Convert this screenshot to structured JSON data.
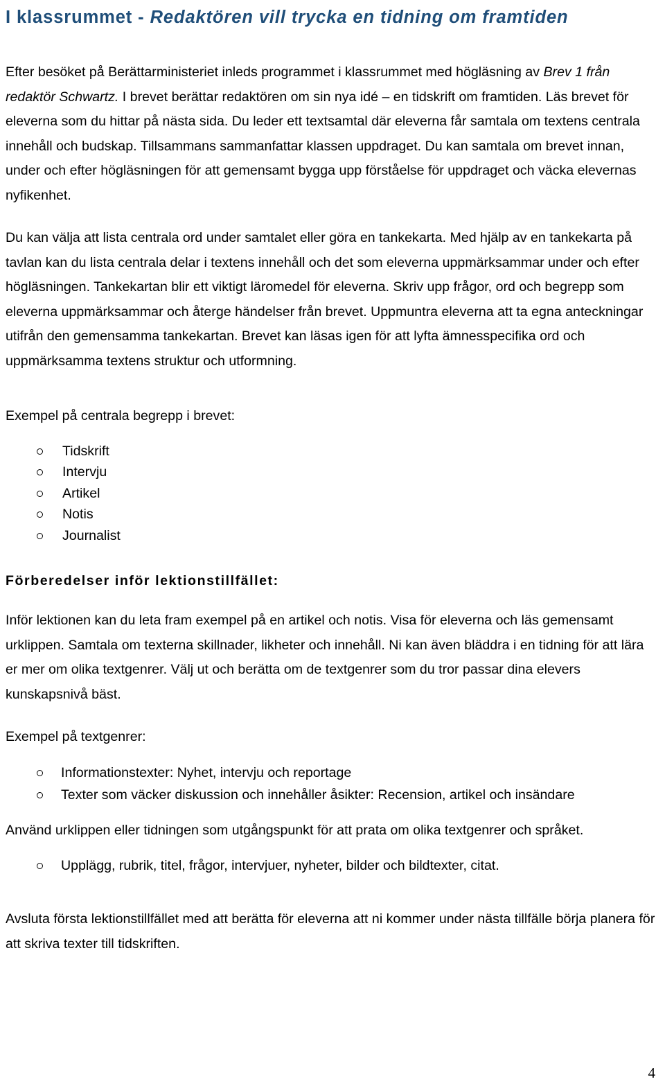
{
  "document": {
    "title_plain": "I klassrummet - ",
    "title_italic": "Redaktören vill trycka en tidning om framtiden",
    "page_number": "4"
  },
  "intro": {
    "p1_run1": "Efter besöket på Berättarministeriet inleds programmet i klassrummet med högläsning av ",
    "p1_run2_italic": "Brev 1 från redaktör Schwartz.",
    "p1_run3": " I brevet berättar redaktören om sin nya idé – en tidskrift om framtiden. Läs brevet för eleverna som du hittar på nästa sida. Du leder ett textsamtal där eleverna får samtala om textens centrala innehåll och budskap. Tillsammans sammanfattar klassen uppdraget. Du kan samtala om brevet innan, under och efter högläsningen för att gemensamt bygga upp förståelse för uppdraget och väcka elevernas nyfikenhet.",
    "p2": "Du kan välja att lista centrala ord under samtalet eller göra en tankekarta. Med hjälp av en tankekarta på tavlan kan du lista centrala delar i textens innehåll och det som eleverna uppmärksammar under och efter högläsningen. Tankekartan blir ett viktigt läromedel för eleverna. Skriv upp frågor, ord och begrepp som eleverna uppmärksammar och återge händelser från brevet. Uppmuntra eleverna att ta egna anteckningar utifrån den gemensamma tankekartan. Brevet kan läsas igen för att lyfta ämnesspecifika ord och uppmärksamma textens struktur och utformning."
  },
  "begrepp_section": {
    "lead": "Exempel på centrala begrepp i brevet:",
    "items": [
      "Tidskrift",
      "Intervju",
      "Artikel",
      "Notis",
      "Journalist"
    ]
  },
  "forberedelser_section": {
    "heading": "Förberedelser inför lektionstillfället:",
    "paragraph": "Inför lektionen kan du leta fram exempel på en artikel och notis. Visa för eleverna och läs gemensamt urklippen. Samtala om texterna skillnader, likheter och innehåll. Ni kan även bläddra i en tidning för att lära er mer om olika textgenrer. Välj ut och berätta om de textgenrer som du tror passar dina elevers kunskapsnivå bäst.",
    "textgenrer_lead": "Exempel på textgenrer:",
    "textgenrer_items": [
      "Informationstexter: Nyhet, intervju och reportage",
      "Texter som väcker diskussion och innehåller åsikter: Recension, artikel och insändare"
    ],
    "urklipp_paragraph": "Använd urklippen eller tidningen som utgångspunkt för att prata om olika textgenrer och språket.",
    "upplagg_items": [
      "Upplägg, rubrik, titel, frågor, intervjuer, nyheter, bilder och bildtexter, citat."
    ]
  },
  "closing": {
    "paragraph": "Avsluta första lektionstillfället med att berätta för eleverna att ni kommer under nästa tillfälle börja planera för att skriva texter till tidskriften."
  },
  "colors": {
    "title": "#1F4E79",
    "body": "#000000",
    "background": "#FFFFFF"
  }
}
